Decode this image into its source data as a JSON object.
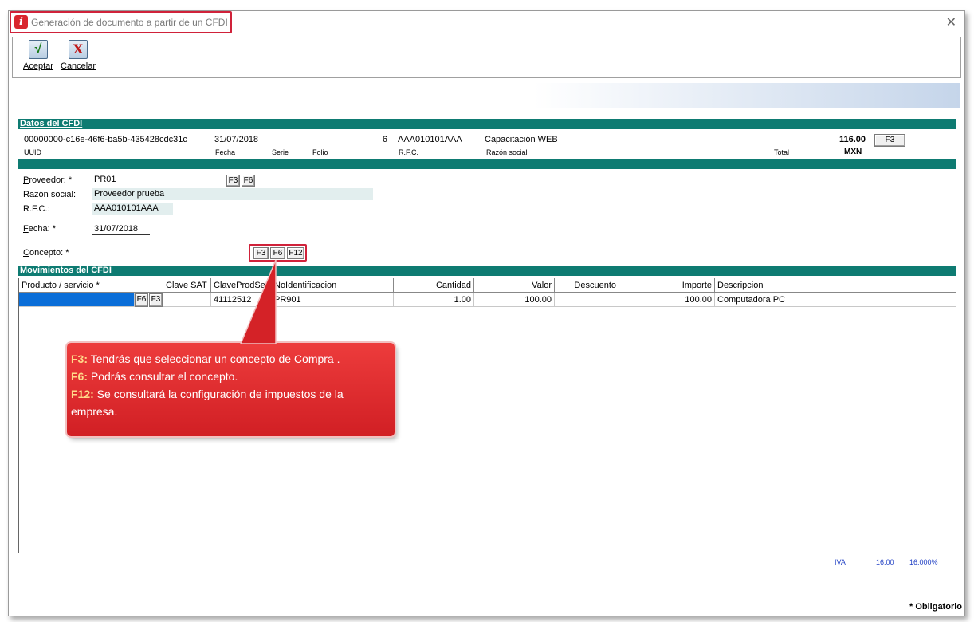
{
  "window": {
    "title": "Generación de documento a partir de un CFDI",
    "close_label": "✕"
  },
  "toolbar": {
    "accept_label": "Aceptar",
    "cancel_label": "Cancelar"
  },
  "cfdi": {
    "section_title": "Datos del CFDI",
    "uuid": "00000000-c16e-46f6-ba5b-435428cdc31c",
    "fecha": "31/07/2018",
    "serie": "",
    "folio": "6",
    "rfc": "AAA010101AAA",
    "razon_social": "Capacitación WEB",
    "total": "116.00",
    "currency": "MXN",
    "f3_label": "F3",
    "captions": {
      "uuid": "UUID",
      "fecha": "Fecha",
      "serie": "Serie",
      "folio": "Folio",
      "rfc": "R.F.C.",
      "razon_social": "Razón social",
      "total": "Total"
    }
  },
  "proveedor": {
    "label_first": "P",
    "label_rest": "roveedor: *",
    "code": "PR01",
    "razon_label": "Razón social:",
    "razon_value": "Proveedor prueba",
    "rfc_label": "R.F.C.:",
    "rfc_value": "AAA010101AAA",
    "f3": "F3",
    "f6": "F6"
  },
  "fecha": {
    "label_first": "F",
    "label_rest": "echa: *",
    "value": "31/07/2018"
  },
  "concepto": {
    "label_first": "C",
    "label_rest": "oncepto: *",
    "value": "",
    "f3": "F3",
    "f6": "F6",
    "f12": "F12"
  },
  "movimientos": {
    "section_title": "Movimientos del CFDI",
    "columns": [
      "Producto / servicio *",
      "Clave SAT",
      "ClaveProdServ",
      "NoIdentificacion",
      "Cantidad",
      "Valor",
      "Descuento",
      "Importe",
      "Descripcion"
    ],
    "rows": [
      {
        "producto": "",
        "clave_sat": "",
        "clave_prod_serv": "41112512",
        "no_identificacion": "PR901",
        "cantidad": "1.00",
        "valor": "100.00",
        "descuento": "",
        "importe": "100.00",
        "descripcion": "Computadora PC"
      }
    ],
    "row_f6": "F6",
    "row_f3": "F3"
  },
  "taxes": {
    "name": "IVA",
    "amount": "16.00",
    "rate": "16.000%"
  },
  "footer": {
    "mandatory": "* Obligatorio"
  },
  "callout": {
    "f3_key": "F3:",
    "f3_text": " Tendrás que seleccionar un concepto de Compra .",
    "f6_key": "F6:",
    "f6_text": " Podrás consultar el concepto.",
    "f12_key": "F12:",
    "f12_text": " Se consultará la configuración de impuestos de la empresa."
  },
  "colors": {
    "teal": "#0e7b72",
    "highlight_red": "#d0223a",
    "callout_red": "#d11f24",
    "selection_blue": "#0a6ed8",
    "tax_blue": "#1f3fc4"
  }
}
